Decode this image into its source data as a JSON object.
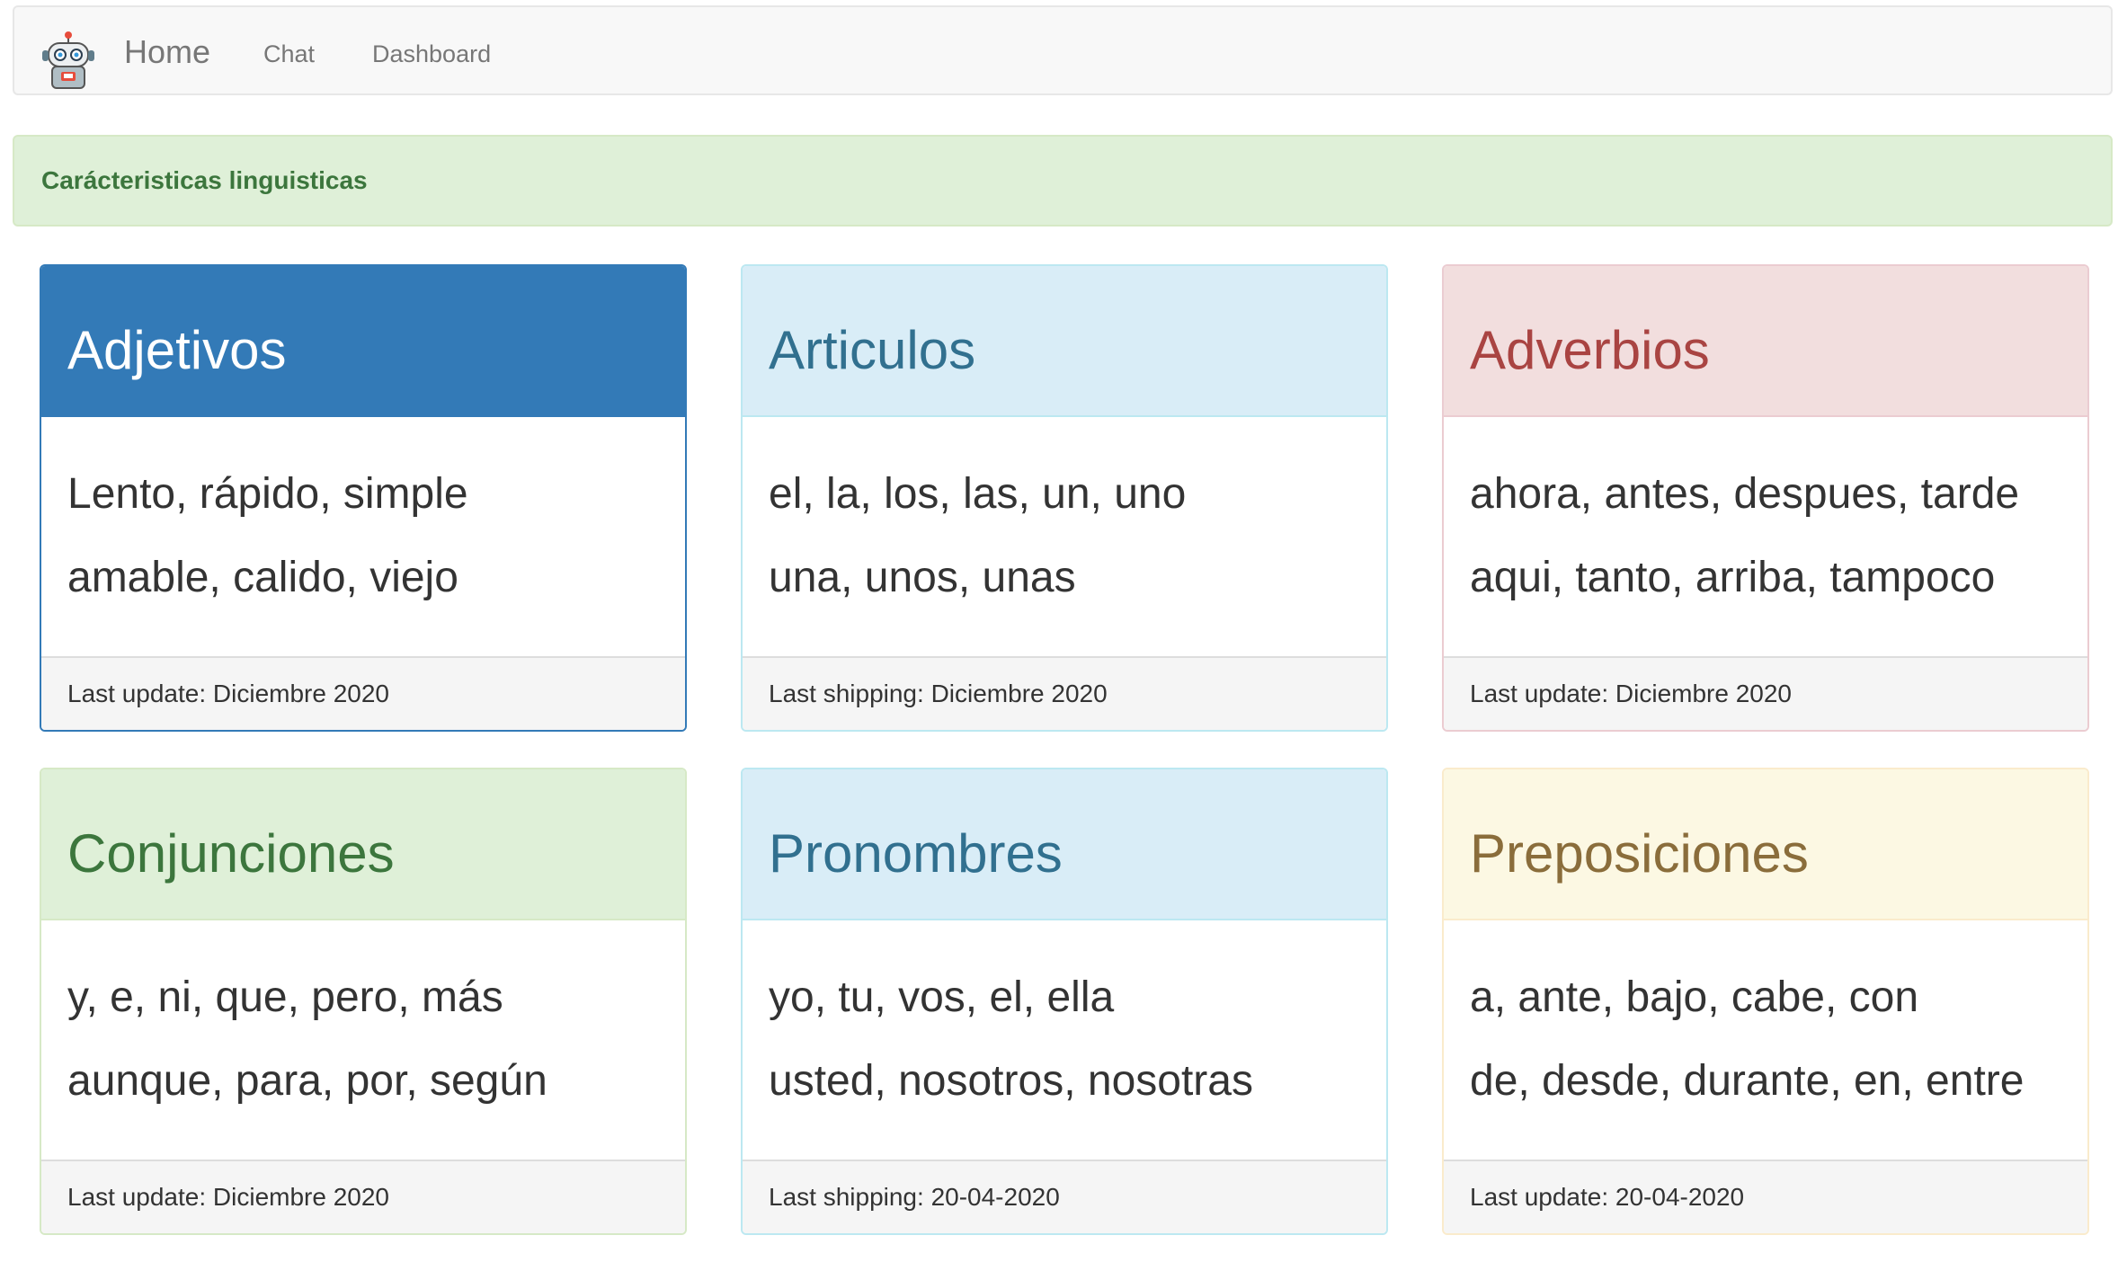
{
  "navbar": {
    "logo_icon": "robot-icon",
    "brand": "Home",
    "links": [
      "Chat",
      "Dashboard"
    ]
  },
  "alert": {
    "text": "Carácteristicas linguisticas"
  },
  "panels": [
    {
      "style": "primary",
      "title": "Adjetivos",
      "lines": [
        "Lento, rápido, simple",
        "amable, calido, viejo"
      ],
      "footer": "Last update: Diciembre 2020"
    },
    {
      "style": "info",
      "title": "Articulos",
      "lines": [
        "el, la, los, las, un, uno",
        "una, unos, unas"
      ],
      "footer": "Last shipping: Diciembre 2020"
    },
    {
      "style": "danger",
      "title": "Adverbios",
      "lines": [
        "ahora, antes, despues, tarde",
        "aqui, tanto, arriba, tampoco"
      ],
      "footer": "Last update: Diciembre 2020"
    },
    {
      "style": "success",
      "title": "Conjunciones",
      "lines": [
        "y, e, ni, que, pero, más",
        "aunque, para, por, según"
      ],
      "footer": "Last update: Diciembre 2020"
    },
    {
      "style": "info",
      "title": "Pronombres",
      "lines": [
        "yo, tu, vos, el, ella",
        "usted, nosotros, nosotras"
      ],
      "footer": "Last shipping: 20-04-2020"
    },
    {
      "style": "warning",
      "title": "Preposiciones",
      "lines": [
        "a, ante, bajo, cabe, con",
        "de, desde, durante, en, entre"
      ],
      "footer": "Last update: 20-04-2020"
    }
  ],
  "colors": {
    "primary": "#337ab7",
    "info": "#d9edf7",
    "danger": "#f2dede",
    "success": "#dff0d8",
    "warning": "#fcf8e3"
  }
}
